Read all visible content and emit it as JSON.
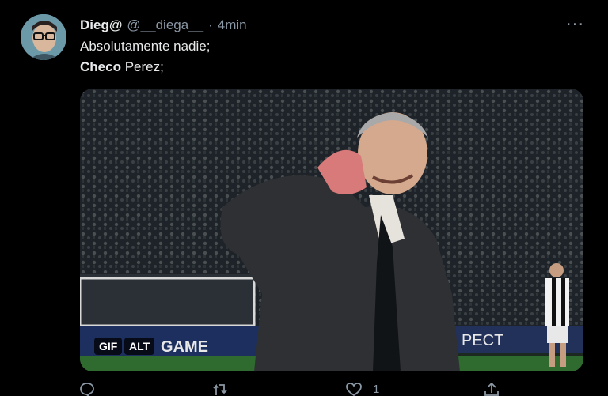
{
  "tweet": {
    "author_name": "Dieg@",
    "author_handle": "@__diega__",
    "separator": "·",
    "time": "4min",
    "more_icon": "more-horizontal-icon",
    "text_line1": "Absolutamente nadie;",
    "text_line2_bold": "Checo",
    "text_line2_rest": " Perez;"
  },
  "media": {
    "gif_badge": "GIF",
    "alt_badge": "ALT",
    "banner_text": "GAME",
    "banner_text_right": "PECT"
  },
  "actions": {
    "reply_icon": "reply-icon",
    "retweet_icon": "retweet-icon",
    "like_icon": "heart-icon",
    "like_count": "1",
    "share_icon": "share-icon"
  },
  "colors": {
    "background": "#000000",
    "text": "#e7e9ea",
    "secondary": "#8b98a5"
  }
}
